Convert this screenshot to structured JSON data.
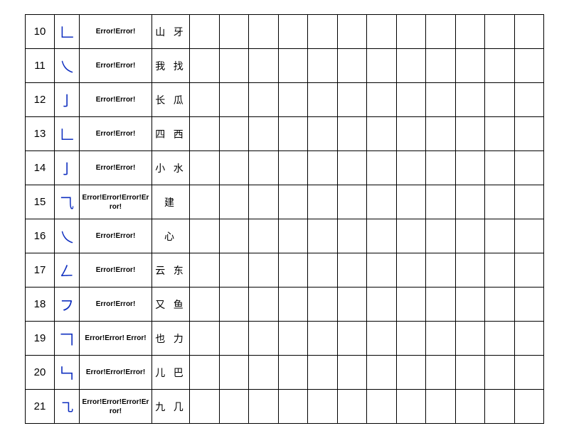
{
  "rows": [
    {
      "num": "10",
      "stroke": "𠃊",
      "err": "Error!Error!",
      "ex": "山 牙"
    },
    {
      "num": "11",
      "stroke": "乀",
      "err": "Error!Error!",
      "ex": "我 找"
    },
    {
      "num": "12",
      "stroke": "亅",
      "err": "Error!Error!",
      "ex": "长 瓜"
    },
    {
      "num": "13",
      "stroke": "𠃊",
      "err": "Error!Error!",
      "ex": "四 西"
    },
    {
      "num": "14",
      "stroke": "亅",
      "err": "Error!Error!",
      "ex": "小 水"
    },
    {
      "num": "15",
      "stroke": "⺄",
      "err": "Error!Error!Error!Error!",
      "ex": "建"
    },
    {
      "num": "16",
      "stroke": "乀",
      "err": "Error!Error!",
      "ex": "心"
    },
    {
      "num": "17",
      "stroke": "𠃋",
      "err": "Error!Error!",
      "ex": "云 东"
    },
    {
      "num": "18",
      "stroke": "フ",
      "err": "Error!Error!",
      "ex": "又 鱼"
    },
    {
      "num": "19",
      "stroke": "𠃍",
      "err": "Error!Error! Error!",
      "ex": "也 力"
    },
    {
      "num": "20",
      "stroke": "𠃑",
      "err": "Error!Error!Error!",
      "ex": "儿 巴"
    },
    {
      "num": "21",
      "stroke": "㇈",
      "err": "Error!Error!Error!Error!",
      "ex": "九 几"
    }
  ],
  "blank_cols": 12
}
